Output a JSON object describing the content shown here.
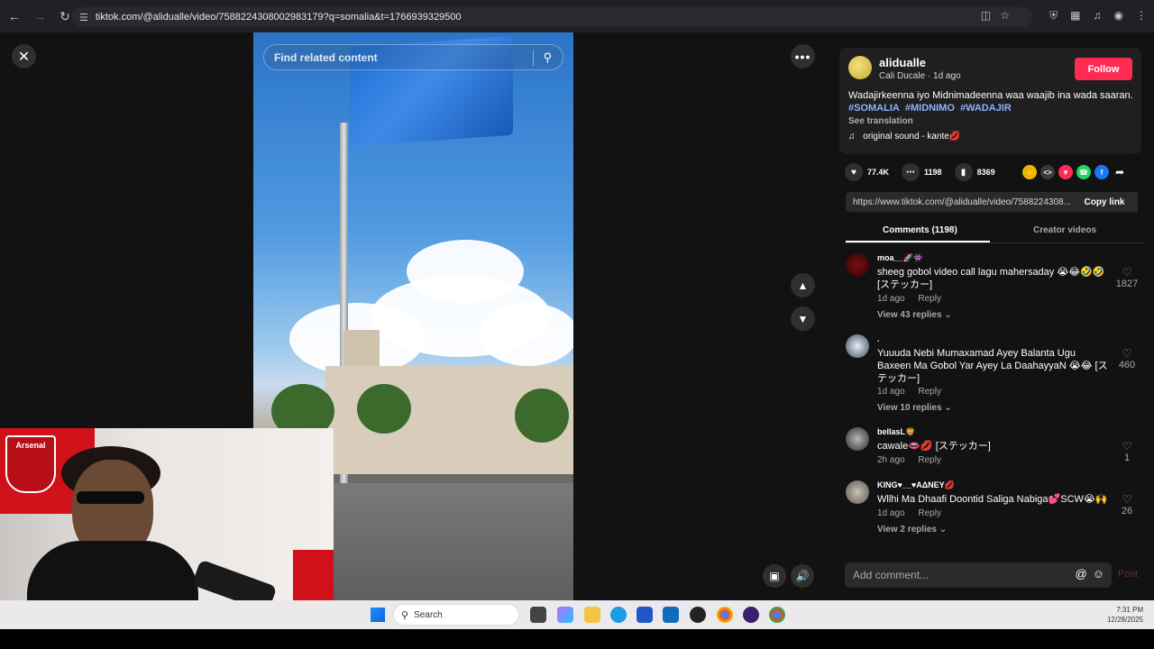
{
  "browser": {
    "url": "tiktok.com/@alidualle/video/7588224308002983179?q=somalia&t=1766939329500",
    "back_icon": "back-arrow-icon",
    "forward_icon": "forward-arrow-icon",
    "reload_icon": "reload-icon"
  },
  "video_overlay": {
    "search_placeholder": "Find related content"
  },
  "author": {
    "username": "alidualle",
    "display_name": "Cali Ducale",
    "posted": "1d ago",
    "follow_label": "Follow"
  },
  "post": {
    "caption": "Wadajirkeenna iyo Midnimadeenna waa waajib ina wada saaran.",
    "hashtags": [
      "#SOMALIA",
      "#MIDNIMO",
      "#WADAJIR"
    ],
    "see_translation": "See translation",
    "sound": "original sound - kante💋"
  },
  "stats": {
    "likes": "77.4K",
    "comments": "1198",
    "saves": "8369"
  },
  "share": {
    "link": "https://www.tiktok.com/@alidualle/video/7588224308...",
    "copy_label": "Copy link"
  },
  "tabs": {
    "comments": "Comments (1198)",
    "creator": "Creator videos"
  },
  "comments": [
    {
      "user": "moa__🚀👾",
      "text": "sheeg gobol video call lagu mahersaday 😭😂🤣🤣 [ステッカー]",
      "time": "1d ago",
      "reply": "Reply",
      "replies": "View 43 replies",
      "likes": "1827"
    },
    {
      "user": ".",
      "text": "Yuuuda Nebi Mumaxamad Ayey Balanta Ugu Baxeen Ma Gobol Yar Ayey La DaahayyaN 😭😂 [ステッカー]",
      "time": "1d ago",
      "reply": "Reply",
      "replies": "View 10 replies",
      "likes": "460"
    },
    {
      "user": "bellasL🦁",
      "text": "cawale👄💋 [ステッカー]",
      "time": "2h ago",
      "reply": "Reply",
      "replies": "",
      "likes": "1"
    },
    {
      "user": "KING♥__♥AΔNEY💋",
      "text": "Wllhi Ma Dhaafi Doontid Saliga Nabiga💕SCW😭🙌",
      "time": "1d ago",
      "reply": "Reply",
      "replies": "View 2 replies",
      "likes": "26"
    }
  ],
  "comment_input": {
    "placeholder": "Add comment...",
    "post_label": "Post"
  },
  "webcam": {
    "banner_text": "Arsenal"
  },
  "taskbar": {
    "search_label": "Search",
    "time": "7:31 PM",
    "date": "12/28/2025"
  }
}
